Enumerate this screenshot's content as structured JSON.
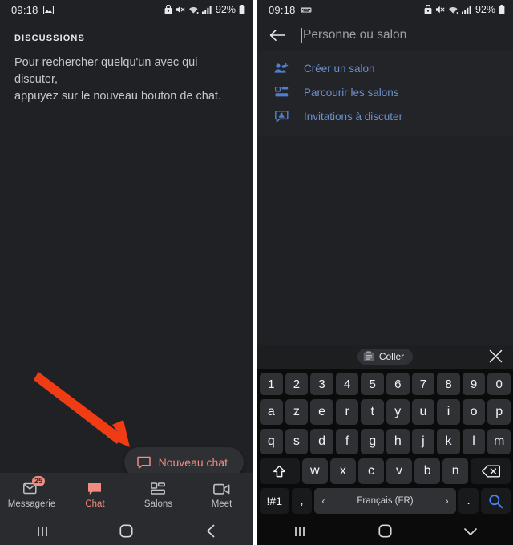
{
  "left": {
    "status": {
      "time": "09:18",
      "left_icon": "image-icon",
      "icons": [
        "alarm-lock-icon",
        "mute-icon",
        "wifi-icon",
        "signal-icon"
      ],
      "battery_percent": "92%"
    },
    "section_label": "DISCUSSIONS",
    "empty_line1": "Pour rechercher quelqu'un avec qui discuter,",
    "empty_line2": "appuyez sur le nouveau bouton de chat.",
    "fab": {
      "label": "Nouveau chat",
      "icon": "chat-bubble-icon",
      "color": "#f28b82"
    },
    "annotation": {
      "type": "arrow",
      "color": "#f03c14",
      "points_to": "Nouveau chat"
    },
    "nav": [
      {
        "label": "Messagerie",
        "icon": "envelope-icon",
        "badge": "25",
        "active": false
      },
      {
        "label": "Chat",
        "icon": "chat-bubble-filled-icon",
        "badge": "",
        "active": true
      },
      {
        "label": "Salons",
        "icon": "rooms-grid-icon",
        "badge": "",
        "active": false
      },
      {
        "label": "Meet",
        "icon": "video-camera-icon",
        "badge": "",
        "active": false
      }
    ],
    "sysnav": [
      "recents-icon",
      "home-icon",
      "back-icon"
    ]
  },
  "right": {
    "status": {
      "time": "09:18",
      "left_icon": "keyboard-icon",
      "icons": [
        "alarm-lock-icon",
        "mute-icon",
        "wifi-icon",
        "signal-icon"
      ],
      "battery_percent": "92%"
    },
    "search": {
      "back_icon": "back-arrow-icon",
      "placeholder": "Personne ou salon",
      "value": ""
    },
    "menu": [
      {
        "label": "Créer un salon",
        "icon": "add-people-icon"
      },
      {
        "label": "Parcourir les salons",
        "icon": "rooms-grid-icon"
      },
      {
        "label": "Invitations à discuter",
        "icon": "chat-invite-icon"
      }
    ],
    "keyboard": {
      "toolbar": {
        "chip_label": "Coller",
        "chip_icon": "clipboard-icon",
        "close_icon": "close-icon"
      },
      "row_numbers": [
        "1",
        "2",
        "3",
        "4",
        "5",
        "6",
        "7",
        "8",
        "9",
        "0"
      ],
      "row1": [
        "a",
        "z",
        "e",
        "r",
        "t",
        "y",
        "u",
        "i",
        "o",
        "p"
      ],
      "row2": [
        "q",
        "s",
        "d",
        "f",
        "g",
        "h",
        "j",
        "k",
        "l",
        "m"
      ],
      "row3": [
        "w",
        "x",
        "c",
        "v",
        "b",
        "n"
      ],
      "shift_icon": "shift-icon",
      "backspace_icon": "backspace-icon",
      "symbols_key": "!#1",
      "comma_key": ",",
      "period_key": ".",
      "space_label": "Français (FR)",
      "space_prev_icon": "chevron-left-icon",
      "space_next_icon": "chevron-right-icon",
      "action_icon": "search-icon",
      "action_color": "#4a86f7"
    },
    "sysnav": [
      "recents-icon",
      "home-icon",
      "keyboard-down-icon"
    ]
  },
  "colors": {
    "background": "#202124",
    "accent_salmon": "#f28b82",
    "accent_blue": "#6e8fd0",
    "annotation_red": "#f03c14"
  }
}
